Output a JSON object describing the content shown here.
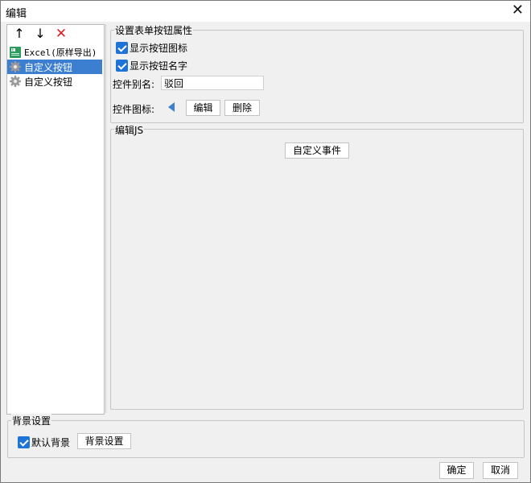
{
  "window": {
    "title": "编辑",
    "close_label": "✕"
  },
  "toolbar": {
    "up": "↑",
    "down": "↓",
    "delete": "✕"
  },
  "tree": {
    "items": [
      {
        "label": "Excel(原样导出)",
        "icon": "excel-icon",
        "selected": false
      },
      {
        "label": "自定义按钮",
        "icon": "gear-icon",
        "selected": true
      },
      {
        "label": "自定义按钮",
        "icon": "gear-icon",
        "selected": false
      }
    ]
  },
  "props": {
    "legend": "设置表单按钮属性",
    "show_icon": {
      "label": "显示按钮图标",
      "checked": true
    },
    "show_name": {
      "label": "显示按钮名字",
      "checked": true
    },
    "alias_label": "控件别名:",
    "alias_value": "驳回",
    "icon_label": "控件图标:",
    "edit_button": "编辑",
    "delete_button": "删除"
  },
  "js": {
    "legend": "编辑JS",
    "custom_event_button": "自定义事件"
  },
  "background": {
    "legend": "背景设置",
    "default_bg": {
      "label": "默认背景",
      "checked": true
    },
    "settings_button": "背景设置"
  },
  "footer": {
    "ok": "确定",
    "cancel": "取消"
  },
  "colors": {
    "selection": "#3c7fd1",
    "checkbox": "#1e73d8",
    "delete_icon": "#e02020",
    "triangle_icon": "#3d7fd0"
  }
}
